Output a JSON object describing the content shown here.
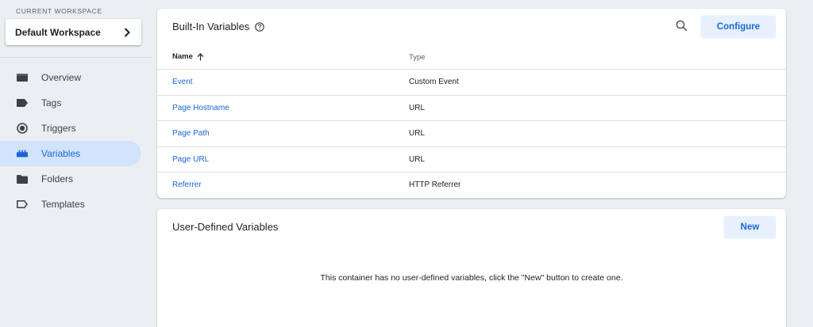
{
  "sidebar": {
    "workspace_label": "CURRENT WORKSPACE",
    "workspace_name": "Default Workspace",
    "items": [
      {
        "label": "Overview",
        "icon": "overview-icon"
      },
      {
        "label": "Tags",
        "icon": "tag-icon"
      },
      {
        "label": "Triggers",
        "icon": "trigger-icon"
      },
      {
        "label": "Variables",
        "icon": "variables-icon",
        "active": true
      },
      {
        "label": "Folders",
        "icon": "folder-icon"
      },
      {
        "label": "Templates",
        "icon": "template-icon"
      }
    ]
  },
  "builtin": {
    "title": "Built-In Variables",
    "configure_label": "Configure",
    "columns": {
      "name": "Name",
      "type": "Type"
    },
    "rows": [
      {
        "name": "Event",
        "type": "Custom Event"
      },
      {
        "name": "Page Hostname",
        "type": "URL"
      },
      {
        "name": "Page Path",
        "type": "URL"
      },
      {
        "name": "Page URL",
        "type": "URL"
      },
      {
        "name": "Referrer",
        "type": "HTTP Referrer"
      }
    ]
  },
  "user_defined": {
    "title": "User-Defined Variables",
    "new_label": "New",
    "empty_message": "This container has no user-defined variables, click the \"New\" button to create one."
  },
  "colors": {
    "accent": "#1967d2",
    "active_bg": "#d2e3fc",
    "button_bg": "#e8f0fe",
    "page_bg": "#eceff1"
  }
}
